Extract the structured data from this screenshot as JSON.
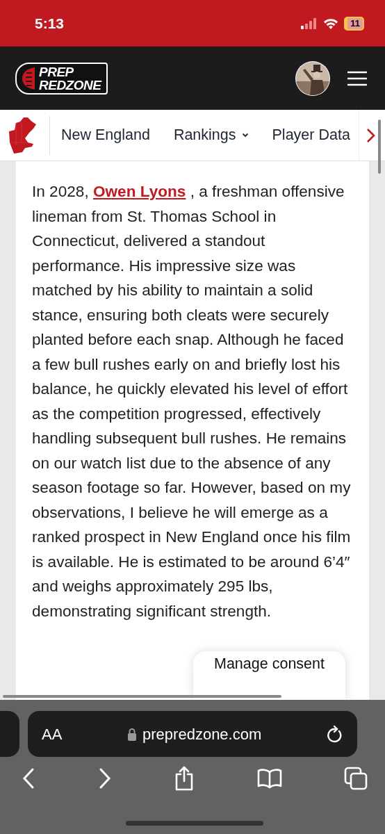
{
  "status_bar": {
    "time": "5:13",
    "battery": "11"
  },
  "header": {
    "logo_top": "PREP",
    "logo_bottom": "REDZONE"
  },
  "nav": {
    "items": [
      {
        "label": "New England",
        "kind": "link"
      },
      {
        "label": "Rankings",
        "kind": "dropdown"
      },
      {
        "label": "Player Data",
        "kind": "link"
      }
    ]
  },
  "article": {
    "before": "In 2028, ",
    "link": "Owen Lyons",
    "after": " , a freshman offensive lineman from St. Thomas School in Connecticut, delivered a standout performance. His impressive size was matched by his ability to maintain a solid stance, ensuring both cleats were securely planted before each snap. Although he faced a few bull rushes early on and briefly lost his balance, he quickly elevated his level of effort as the competition progressed, effectively handling subsequent bull rushes. He remains on our watch list due to the absence of any season footage so far. However, based on my observations, I believe he will emerge as a ranked prospect in New England once his film is available. He is estimated to be around 6’4″ and weighs approximately 295 lbs, demonstrating significant strength."
  },
  "consent": {
    "label": "Manage consent"
  },
  "browser": {
    "text_size": "AA",
    "url": "prepredzone.com"
  }
}
